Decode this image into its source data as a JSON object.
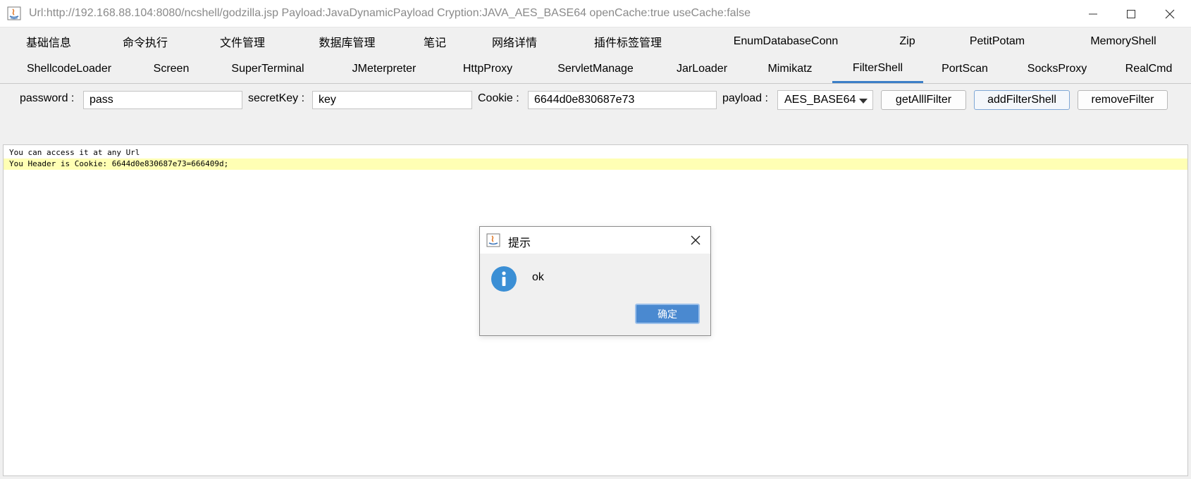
{
  "window": {
    "title": "Url:http://192.168.88.104:8080/ncshell/godzilla.jsp Payload:JavaDynamicPayload Cryption:JAVA_AES_BASE64 openCache:true useCache:false"
  },
  "tabs": {
    "row1": [
      "基础信息",
      "命令执行",
      "文件管理",
      "数据库管理",
      "笔记",
      "网络详情",
      "插件标签管理",
      "EnumDatabaseConn",
      "Zip",
      "PetitPotam",
      "MemoryShell"
    ],
    "row2": [
      "ShellcodeLoader",
      "Screen",
      "SuperTerminal",
      "JMeterpreter",
      "HttpProxy",
      "ServletManage",
      "JarLoader",
      "Mimikatz",
      "FilterShell",
      "PortScan",
      "SocksProxy",
      "RealCmd"
    ],
    "active": "FilterShell"
  },
  "form": {
    "password_label": "password :",
    "password_value": "pass",
    "secretkey_label": "secretKey :",
    "secretkey_value": "key",
    "cookie_label": "Cookie :",
    "cookie_value": "6644d0e830687e73",
    "payload_label": "payload :",
    "payload_selected": "AES_BASE64",
    "btn_get": "getAlllFilter",
    "btn_add": "addFilterShell",
    "btn_remove": "removeFilter"
  },
  "output": {
    "lines": [
      "You can access it at any Url",
      "You Header is Cookie: 6644d0e830687e73=666409d;"
    ]
  },
  "dialog": {
    "title": "提示",
    "message": "ok",
    "ok_label": "确定"
  },
  "colors": {
    "accent": "#3c7fc7",
    "highlight": "#ffffb4",
    "info": "#3b8fd5",
    "ok_button": "#4a89d0"
  }
}
